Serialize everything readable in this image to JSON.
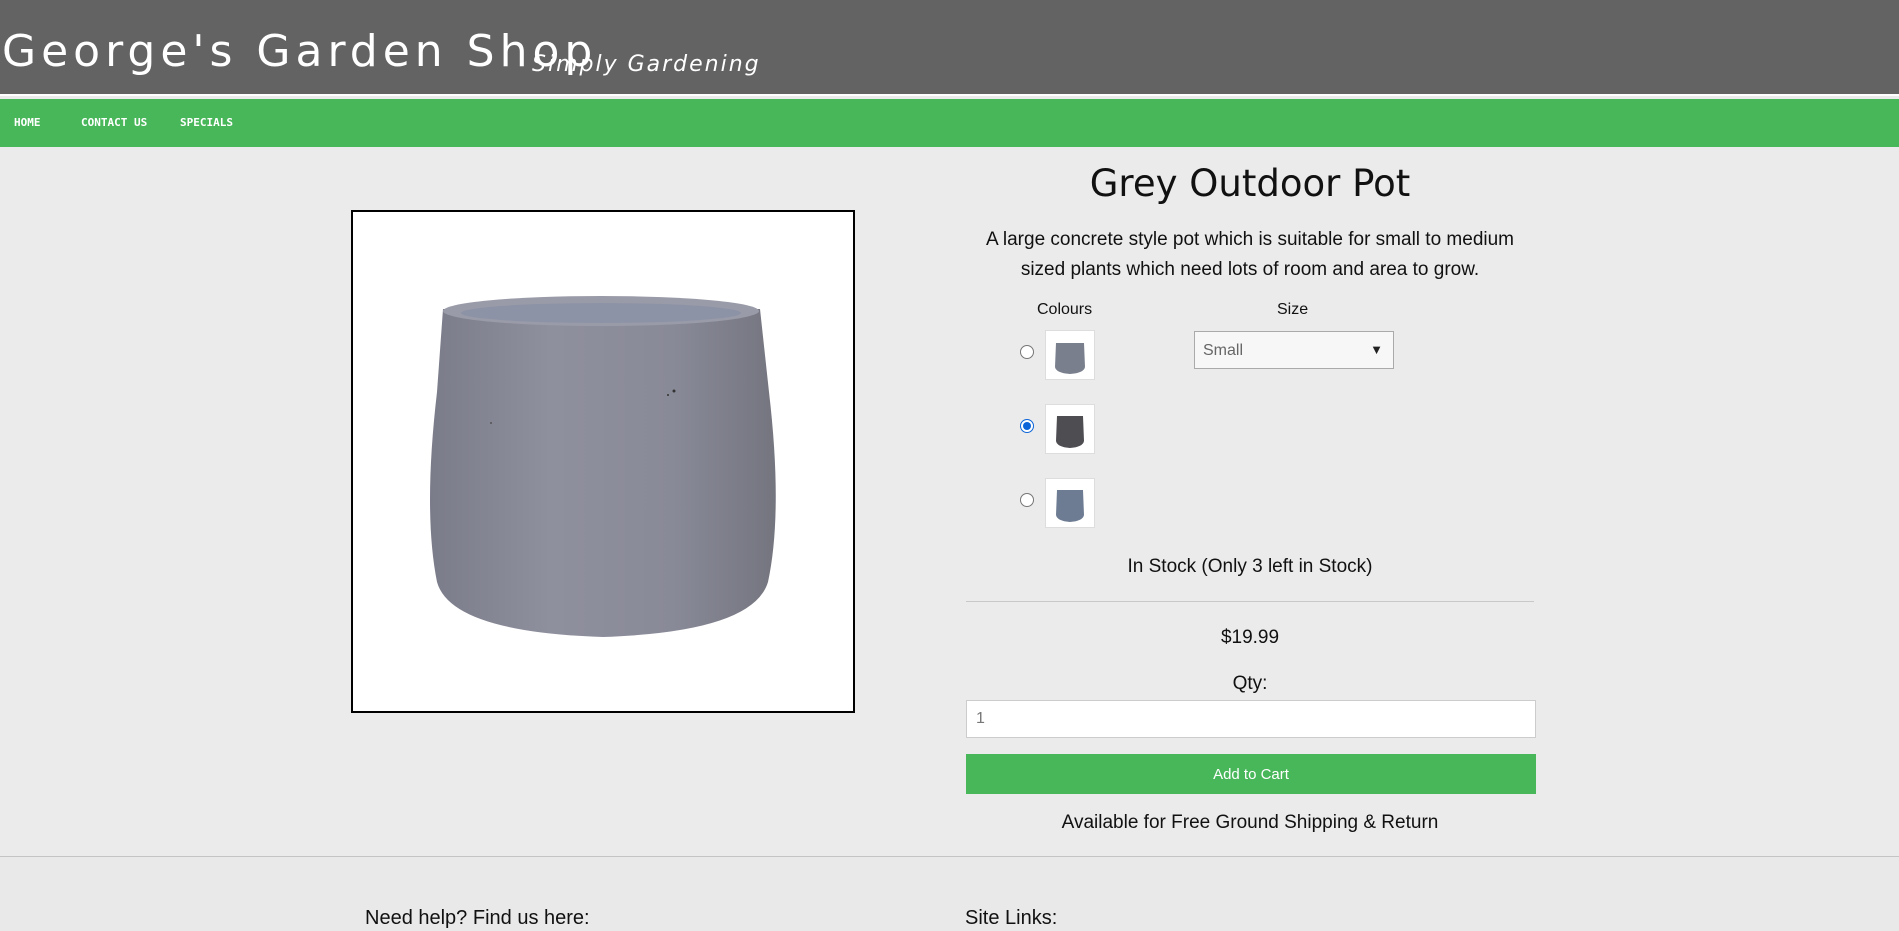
{
  "header": {
    "site_title": "George's Garden Shop",
    "tagline": "Simply Gardening"
  },
  "nav": {
    "items": [
      {
        "label": "HOME"
      },
      {
        "label": "CONTACT US"
      },
      {
        "label": "SPECIALS"
      }
    ]
  },
  "product": {
    "title": "Grey Outdoor Pot",
    "description_line1": "A large concrete style pot which is suitable for small to medium",
    "description_line2": "sized plants which need lots of room and area to grow.",
    "colours_label": "Colours",
    "size_label": "Size",
    "colour_options": [
      {
        "color": "#7a7f8e",
        "selected": false
      },
      {
        "color": "#4d4d52",
        "selected": true
      },
      {
        "color": "#6d7c92",
        "selected": false
      }
    ],
    "size_selected": "Small",
    "stock_text": "In Stock (Only 3 left in Stock)",
    "price": "$19.99",
    "qty_label": "Qty:",
    "qty_value": "1",
    "add_to_cart_label": "Add to Cart",
    "shipping_text": "Available for Free Ground Shipping & Return",
    "image_color": "#8b8c9a"
  },
  "footer": {
    "help_heading": "Need help? Find us here:",
    "links_heading": "Site Links:"
  },
  "colors": {
    "header_bg": "#636363",
    "nav_bg": "#48b75a",
    "accent_green": "#48b75a",
    "page_bg": "#ebebeb"
  }
}
